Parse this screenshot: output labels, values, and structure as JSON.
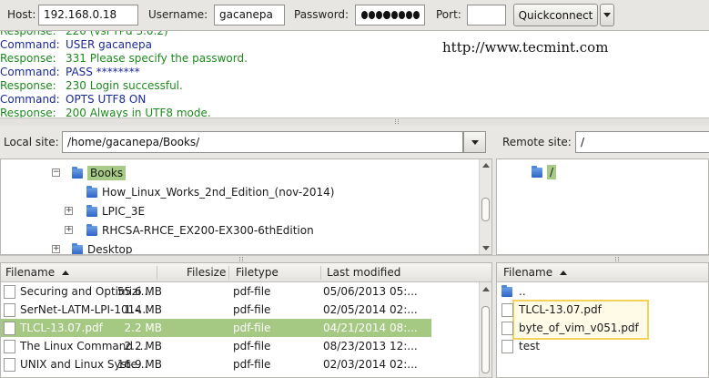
{
  "quickconnect": {
    "host_label": "Host:",
    "host_value": "192.168.0.18",
    "username_label": "Username:",
    "username_value": "gacanepa",
    "password_label": "Password:",
    "password_dots": 8,
    "port_label": "Port:",
    "port_value": "",
    "quickconnect_label": "Quickconnect"
  },
  "message_log": {
    "lines": [
      {
        "kind": "Response:",
        "text": "220 (vsFTPd 3.0.2)",
        "type": "resp"
      },
      {
        "kind": "Command:",
        "text": "USER gacanepa",
        "type": "cmd"
      },
      {
        "kind": "Response:",
        "text": "331 Please specify the password.",
        "type": "resp"
      },
      {
        "kind": "Command:",
        "text": "PASS ********",
        "type": "cmd"
      },
      {
        "kind": "Response:",
        "text": "230 Login successful.",
        "type": "resp"
      },
      {
        "kind": "Command:",
        "text": "OPTS UTF8 ON",
        "type": "cmd"
      },
      {
        "kind": "Response:",
        "text": "200 Always in UTF8 mode.",
        "type": "resp"
      }
    ],
    "watermark": "http://www.tecmint.com"
  },
  "local": {
    "site_label": "Local site:",
    "site_path": "/home/gacanepa/Books/",
    "tree": [
      {
        "label": "Books",
        "expander": "−",
        "selected": true
      },
      {
        "label": "How_Linux_Works_2nd_Edition_(nov-2014)",
        "expander": "",
        "selected": false
      },
      {
        "label": "LPIC_3E",
        "expander": "+",
        "selected": false
      },
      {
        "label": "RHCSA-RHCE_EX200-EX300-6thEdition",
        "expander": "+",
        "selected": false
      },
      {
        "label": "Desktop",
        "expander": "+",
        "selected": false
      }
    ],
    "columns": [
      "Filename",
      "Filesize",
      "Filetype",
      "Last modified"
    ],
    "files": [
      {
        "name": "Securing and Optimizi...",
        "size": "55.6 MB",
        "type": "pdf-file",
        "modified": "05/06/2013 05:..."
      },
      {
        "name": "SerNet-LATM-LPI-101-...",
        "size": "1.4 MB",
        "type": "pdf-file",
        "modified": "02/05/2014 02:..."
      },
      {
        "name": "TLCL-13.07.pdf",
        "size": "2.2 MB",
        "type": "pdf-file",
        "modified": "04/21/2014 08:..."
      },
      {
        "name": "The Linux Command ...",
        "size": "2.2 MB",
        "type": "pdf-file",
        "modified": "08/23/2013 12:..."
      },
      {
        "name": "UNIX and Linux Syste...",
        "size": "16.9 MB",
        "type": "pdf-file",
        "modified": "02/03/2014 02:..."
      }
    ],
    "selected_file_index": 2
  },
  "remote": {
    "site_label": "Remote site:",
    "site_path": "/",
    "tree_root": "/",
    "columns": [
      "Filename"
    ],
    "files": [
      {
        "name": "..",
        "kind": "parent"
      },
      {
        "name": "TLCL-13.07.pdf",
        "kind": "file"
      },
      {
        "name": "byte_of_vim_v051.pdf",
        "kind": "file"
      },
      {
        "name": "test",
        "kind": "file"
      }
    ]
  },
  "colors": {
    "response": "#1d8a1d",
    "command": "#1b2a9b",
    "selection": "#a5c882",
    "highlight_border": "#f2d25a"
  }
}
